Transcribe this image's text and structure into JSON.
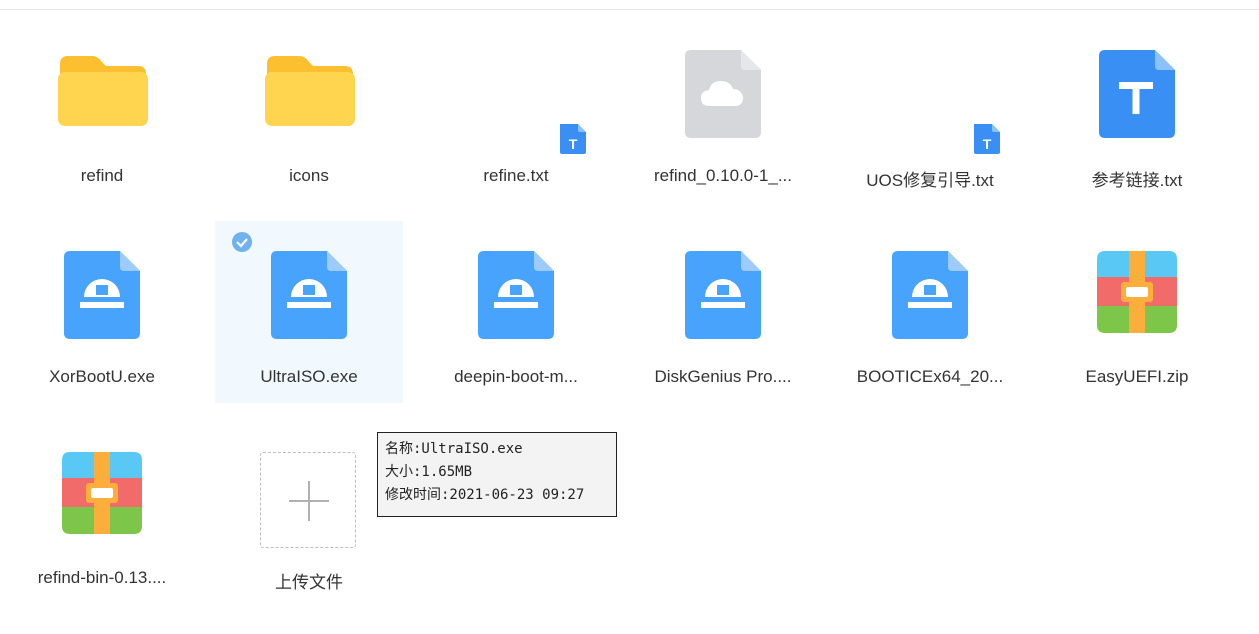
{
  "colors": {
    "folder": "#ffd54f",
    "folder_back": "#fcbf2f",
    "exe_blue": "#47a3fb",
    "doc_blue": "#3a8ff5",
    "cloud_gray": "#d6d7da",
    "selected_bg": "#f1f8fe",
    "check_blue": "#6fb2ee"
  },
  "files": [
    {
      "name": "refind",
      "icon": "folder-icon"
    },
    {
      "name": "icons",
      "icon": "folder-icon"
    },
    {
      "name": "refine.txt",
      "icon": "text-file-icon"
    },
    {
      "name": "refind_0.10.0-1_...",
      "icon": "cloud-file-icon"
    },
    {
      "name": "UOS修复引导.txt",
      "icon": "text-file-icon"
    },
    {
      "name": "参考链接.txt",
      "icon": "text-document-icon"
    },
    {
      "name": "XorBootU.exe",
      "icon": "executable-icon"
    },
    {
      "name": "UltraISO.exe",
      "icon": "executable-icon",
      "selected": true
    },
    {
      "name": "deepin-boot-m...",
      "icon": "executable-icon"
    },
    {
      "name": "DiskGenius Pro....",
      "icon": "executable-icon"
    },
    {
      "name": "BOOTICEx64_20...",
      "icon": "executable-icon"
    },
    {
      "name": "EasyUEFI.zip",
      "icon": "archive-icon"
    },
    {
      "name": "refind-bin-0.13....",
      "icon": "archive-icon"
    }
  ],
  "upload": {
    "label": "上传文件",
    "icon": "plus-icon"
  },
  "tooltip": {
    "name_line": "名称:UltraISO.exe",
    "size_line": "大小:1.65MB",
    "modified_line": "修改时间:2021-06-23 09:27"
  }
}
